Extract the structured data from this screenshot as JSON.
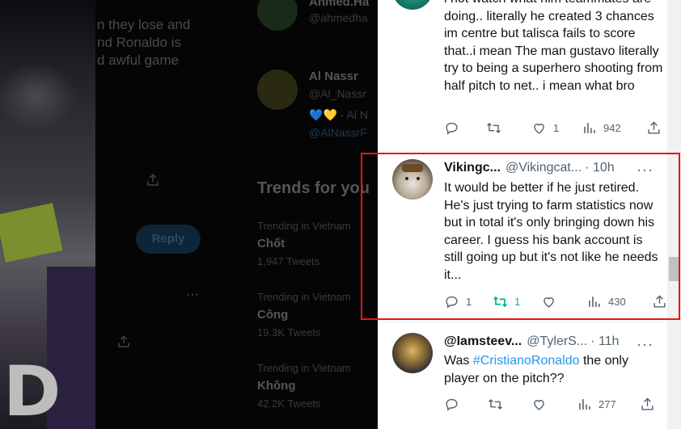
{
  "background": {
    "main_fragments": [
      "n they lose and",
      "nd Ronaldo is",
      "d awful game"
    ],
    "side_handle_top": "@ahmedha",
    "side_name_top": "Ahmed.Ha",
    "side_name_2": "Al Nassr",
    "side_handle_2": "@Al_Nassr",
    "side_text_2": "- Al N",
    "side_link_2": "@AlNassrF",
    "trends_heading": "Trends for you",
    "reply_label": "Reply",
    "trends": [
      {
        "context": "Trending in Vietnam",
        "name": "Chốt",
        "count": "1,947 Tweets"
      },
      {
        "context": "Trending in Vietnam",
        "name": "Công",
        "count": "19.3K Tweets"
      },
      {
        "context": "Trending in Vietnam",
        "name": "Không",
        "count": "42.2K Tweets"
      }
    ]
  },
  "tweets": [
    {
      "name": "",
      "handle": "",
      "time": "",
      "text": "i not watch what him teammates are doing.. literally he created 3 chances im centre but talisca fails to score that..i mean The man gustavo literally try to being a superhero shooting from half pitch to net.. i mean what bro",
      "replies": "",
      "retweets": "",
      "likes": "1",
      "views": "942"
    },
    {
      "name": "Vikingc...",
      "handle": "@Vikingcat...",
      "time": "· 10h",
      "text": "It would be better if he just retired. He's just trying to farm statistics now but in total it's only bringing down his career. I guess his bank account is still going up but it's not like he needs it...",
      "replies": "1",
      "retweets": "1",
      "likes": "",
      "views": "430"
    },
    {
      "name": "@Iamsteev...",
      "handle": "@TylerS...",
      "time": "· 11h",
      "text_before": "Was ",
      "hashtag": "#CristianoRonaldo",
      "text_after": " the only player on the pitch??",
      "replies": "",
      "retweets": "",
      "likes": "",
      "views": "277"
    }
  ],
  "colors": {
    "text": "#0f1419",
    "secondary": "#536471",
    "link": "#1d9bf0",
    "retweet_active": "#00ba7c",
    "highlight": "#e81515"
  }
}
